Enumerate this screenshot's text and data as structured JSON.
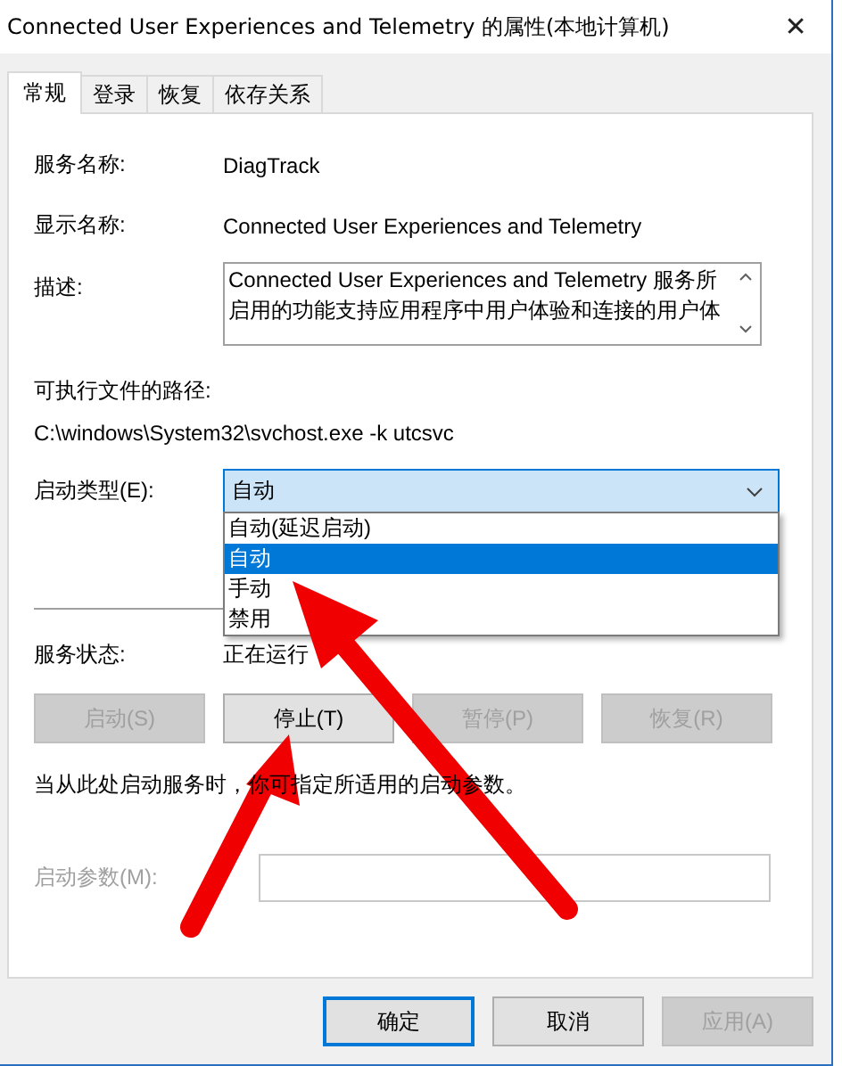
{
  "window": {
    "title": "Connected User Experiences and Telemetry 的属性(本地计算机)",
    "close": "✕"
  },
  "tabs": [
    {
      "label": "常规",
      "selected": true
    },
    {
      "label": "登录",
      "selected": false
    },
    {
      "label": "恢复",
      "selected": false
    },
    {
      "label": "依存关系",
      "selected": false
    }
  ],
  "general": {
    "service_name_label": "服务名称:",
    "service_name": "DiagTrack",
    "display_name_label": "显示名称:",
    "display_name": "Connected User Experiences and Telemetry",
    "description_label": "描述:",
    "description": "Connected User Experiences and Telemetry 服务所启用的功能支持应用程序中用户体验和连接的用户体",
    "path_label": "可执行文件的路径:",
    "path": "C:\\windows\\System32\\svchost.exe -k utcsvc",
    "startup_type_label": "启动类型(E):",
    "startup_type": {
      "value": "自动",
      "expanded": true,
      "options": [
        {
          "label": "自动(延迟启动)",
          "selected": false
        },
        {
          "label": "自动",
          "selected": true
        },
        {
          "label": "手动",
          "selected": false
        },
        {
          "label": "禁用",
          "selected": false
        }
      ]
    },
    "status_label": "服务状态:",
    "status": "正在运行",
    "service_buttons": [
      {
        "label": "启动(S)",
        "disabled": true
      },
      {
        "label": "停止(T)",
        "disabled": false
      },
      {
        "label": "暂停(P)",
        "disabled": true
      },
      {
        "label": "恢复(R)",
        "disabled": true
      }
    ],
    "hint": "当从此处启动服务时，你可指定所适用的启动参数。",
    "params_label": "启动参数(M):",
    "params_disabled": true
  },
  "buttons": [
    {
      "label": "确定",
      "disabled": false,
      "focused": true
    },
    {
      "label": "取消",
      "disabled": false,
      "focused": false
    },
    {
      "label": "应用(A)",
      "disabled": true,
      "focused": false
    }
  ]
}
